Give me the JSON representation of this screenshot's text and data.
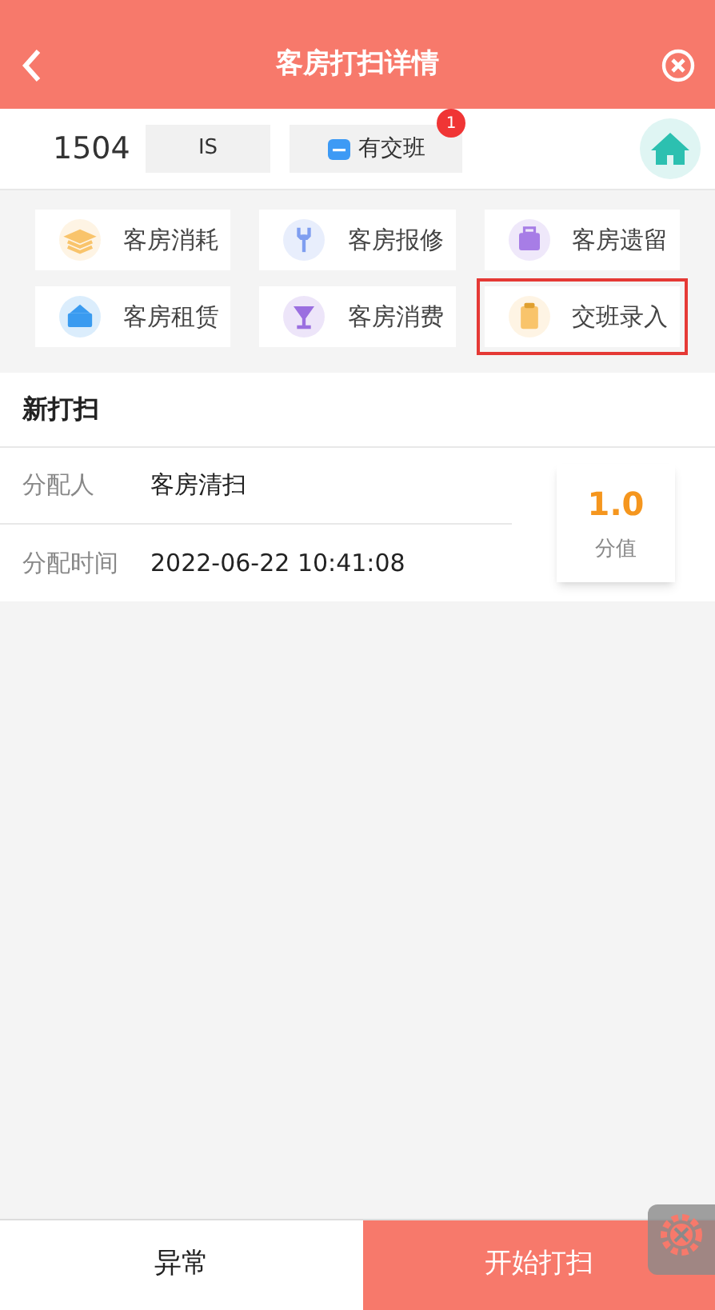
{
  "header": {
    "title": "客房打扫详情"
  },
  "room": {
    "number": "1504",
    "status": "IS",
    "handover": {
      "label": "有交班",
      "badge": "1"
    }
  },
  "actions": [
    {
      "label": "客房消耗",
      "highlighted": false
    },
    {
      "label": "客房报修",
      "highlighted": false
    },
    {
      "label": "客房遗留",
      "highlighted": false
    },
    {
      "label": "客房租赁",
      "highlighted": false
    },
    {
      "label": "客房消费",
      "highlighted": false
    },
    {
      "label": "交班录入",
      "highlighted": true
    }
  ],
  "task": {
    "title": "新打扫",
    "fields": [
      {
        "label": "分配人",
        "value": "客房清扫"
      },
      {
        "label": "分配时间",
        "value": "2022-06-22 10:41:08"
      }
    ],
    "score": {
      "value": "1.0",
      "label": "分值"
    }
  },
  "footer": {
    "secondary": "异常",
    "primary": "开始打扫"
  }
}
